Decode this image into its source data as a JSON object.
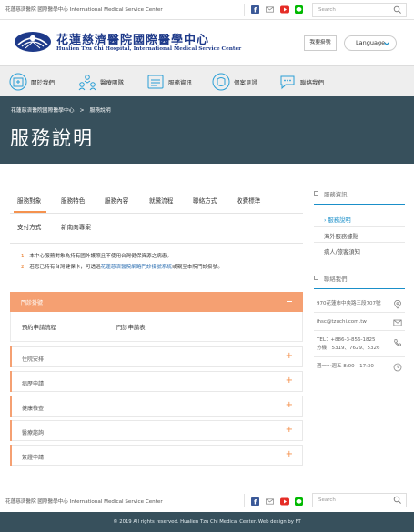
{
  "topbar": {
    "site_name": "花蓮慈濟醫院 國際醫學中心 International Medical Service Center",
    "social": [
      "facebook-icon",
      "mail-icon",
      "youtube-icon",
      "line-icon"
    ],
    "search_placeholder": "Search"
  },
  "header": {
    "logo_title": "花蓮慈濟醫院國際醫學中心",
    "logo_subtitle": "Hualien Tzu Chi Hospital, International Medical Service Center",
    "register_button": "我要掛號",
    "language_button": "Language"
  },
  "nav": {
    "items": [
      {
        "label": "關於我們",
        "icon": "hospital-icon"
      },
      {
        "label": "醫療團隊",
        "icon": "team-icon"
      },
      {
        "label": "服務資訊",
        "icon": "service-info-icon"
      },
      {
        "label": "個案見證",
        "icon": "case-icon"
      },
      {
        "label": "聯絡我們",
        "icon": "chat-icon"
      }
    ]
  },
  "hero": {
    "breadcrumb": [
      "花蓮慈濟醫院國際醫學中心",
      ">",
      "服務說明"
    ],
    "title": "服務說明"
  },
  "tabs": {
    "row1": [
      "服務對象",
      "服務特色",
      "服務內容",
      "就醫流程",
      "聯絡方式",
      "收費標準"
    ],
    "row2": [
      "支付方式",
      "新南向專案"
    ],
    "active": "服務對象"
  },
  "notes": [
    {
      "num": "1.",
      "text": "本中心服務對象為持有國外護照且不使用台灣健保資源之病患。"
    },
    {
      "num": "2.",
      "pre": "若您已持有台灣健保卡，可透過",
      "link": "花蓮慈濟醫院網路門診掛號系統",
      "post": "或親至本院門診掛號。"
    }
  ],
  "accordion": {
    "open": {
      "title": "門診掛號",
      "links": [
        "預約申請流程",
        "門診申請表"
      ]
    },
    "closed": [
      "住院安排",
      "病歷申請",
      "健康檢查",
      "醫療諮詢",
      "簽證申請"
    ]
  },
  "sidebar": {
    "service_heading": "服務資訊",
    "links": [
      {
        "label": "服務說明",
        "active": true
      },
      {
        "label": "海外服務據點",
        "active": false
      },
      {
        "label": "病人/旅客須知",
        "active": false
      }
    ],
    "contact_heading": "聯絡我們",
    "contact": {
      "address": "970花蓮市中央路三段707號",
      "email": "ihsc@tzuchi.com.tw",
      "tel": "TEL：+886-3-856-1825",
      "ext": "分機：5319、7629、5326",
      "hours": "週一～週五 8:00 - 17:30"
    }
  },
  "footer": {
    "site_name": "花蓮慈濟醫院 國際醫學中心 International Medical Service Center",
    "search_placeholder": "Search",
    "copyright": "© 2019 All rights reserved. Hualien Tzu Chi Medical Center. Web design by FT"
  },
  "colors": {
    "accent_orange": "#f5a072",
    "hero_bg": "#37505c",
    "link_blue": "#1a8fc9",
    "logo_navy": "#1e3a8a"
  }
}
